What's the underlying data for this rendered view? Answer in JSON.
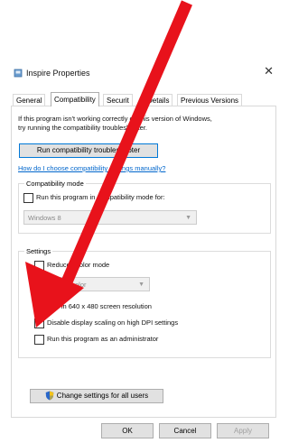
{
  "window": {
    "title": "Inspire Properties",
    "close_glyph": "✕"
  },
  "tabs": [
    {
      "label": "General"
    },
    {
      "label": "Compatibility"
    },
    {
      "label": "Securit"
    },
    {
      "label": "Details"
    },
    {
      "label": "Previous Versions"
    }
  ],
  "intro": {
    "line1": "If this program isn't working correctly on this version of Windows,",
    "line2": "try running the compatibility troubleshooter."
  },
  "troubleshooter_button": "Run compatibility troubleshooter",
  "manual_link": "How do I choose compatibility settings manually?",
  "compat_mode": {
    "legend": "Compatibility mode",
    "checkbox_label": "Run this program in compatibility mode for:",
    "select_value": "Windows 8"
  },
  "settings": {
    "legend": "Settings",
    "reduced_color": "Reduced color mode",
    "color_select": "8-bit (256) color",
    "run_640": "Run in 640 x 480 screen resolution",
    "disable_dpi": "Disable display scaling on high DPI settings",
    "run_admin": "Run this program as an administrator"
  },
  "all_users_button": "Change settings for all users",
  "footer": {
    "ok": "OK",
    "cancel": "Cancel",
    "apply": "Apply"
  },
  "colors": {
    "arrow": "#e8121b",
    "link": "#0066cc",
    "focus_border": "#0078d7"
  }
}
